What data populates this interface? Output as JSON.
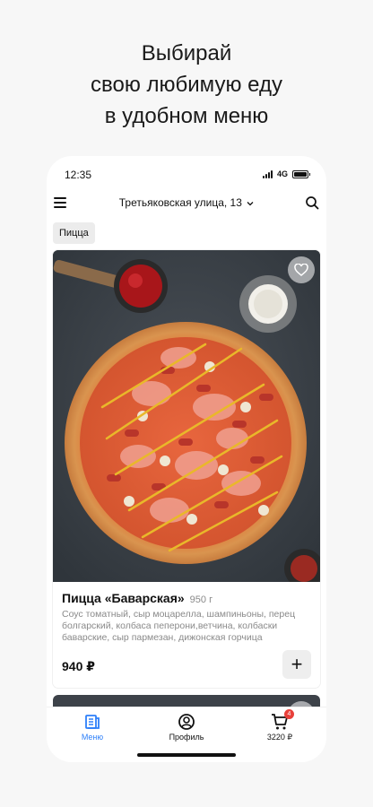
{
  "headline": {
    "line1": "Выбирай",
    "line2": "свою любимую еду",
    "line3": "в удобном меню"
  },
  "status_bar": {
    "time": "12:35",
    "network": "4G"
  },
  "header": {
    "address": "Третьяковская улица, 13"
  },
  "category_chip": "Пицца",
  "product": {
    "name": "Пицца «Баварская»",
    "weight": "950 г",
    "description": "Соус томатный, сыр моцарелла, шампиньоны, перец болгарский, колбаса пеперони,ветчина, колбаски баварские, сыр пармезан, дижонская горчица",
    "price": "940 ₽",
    "add_label": "+"
  },
  "tabbar": {
    "menu_label": "Меню",
    "profile_label": "Профиль",
    "cart_total": "3220 ₽",
    "cart_count": "4"
  },
  "colors": {
    "accent": "#2d7ff9",
    "badge": "#e8403a",
    "background": "#f7f7f7"
  },
  "icons": [
    "hamburger-menu-icon",
    "chevron-down-icon",
    "search-icon",
    "heart-icon",
    "plus-icon",
    "menu-book-icon",
    "user-circle-icon",
    "cart-icon"
  ]
}
